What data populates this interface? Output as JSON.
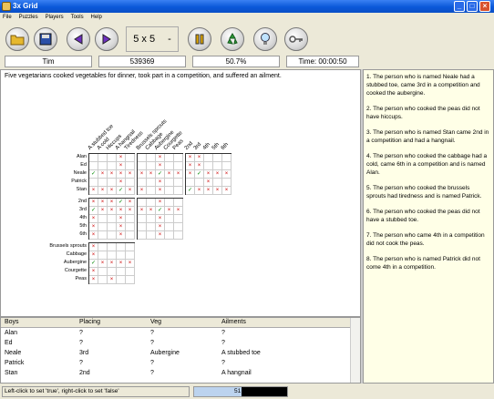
{
  "window": {
    "title": "3x Grid"
  },
  "menu": [
    "File",
    "Puzzles",
    "Players",
    "Tools",
    "Help"
  ],
  "toolbar": {
    "size": "5 x 5",
    "size_suffix": "-"
  },
  "status": {
    "player": "Tim",
    "score": "539369",
    "percent": "50.7%",
    "time": "Time: 00:00:50"
  },
  "intro": "Five vegetarians cooked vegetables for dinner, took part in a competition, and suffered an ailment.",
  "columns": {
    "ailments": [
      "A stubbed toe",
      "A cold",
      "Hiccups",
      "A hangnail",
      "Tiredness"
    ],
    "veg": [
      "Brussels sprouts",
      "Cabbage",
      "Aubergine",
      "Courgette",
      "Peas"
    ],
    "placing": [
      "2nd",
      "3rd",
      "4th",
      "5th",
      "6th"
    ]
  },
  "rows": {
    "boys": [
      "Alan",
      "Ed",
      "Neale",
      "Patrick",
      "Stan"
    ],
    "placing": [
      "2nd",
      "3rd",
      "4th",
      "5th",
      "6th"
    ],
    "veg": [
      "Brussels sprouts",
      "Cabbage",
      "Aubergine",
      "Courgette",
      "Peas"
    ]
  },
  "grid_marks": {
    "boys_ailments": [
      [
        "",
        "",
        "",
        "x",
        ""
      ],
      [
        "",
        "",
        "",
        "x",
        ""
      ],
      [
        "c",
        "x",
        "x",
        "x",
        "x"
      ],
      [
        "",
        "",
        "",
        "x",
        ""
      ],
      [
        "x",
        "x",
        "x",
        "c",
        "x"
      ]
    ],
    "boys_veg": [
      [
        "",
        "",
        "x",
        "",
        ""
      ],
      [
        "",
        "",
        "x",
        "",
        ""
      ],
      [
        "x",
        "x",
        "c",
        "x",
        "x"
      ],
      [
        "",
        "",
        "x",
        "",
        ""
      ],
      [
        "x",
        "",
        "x",
        "",
        ""
      ]
    ],
    "boys_placing": [
      [
        "x",
        "x",
        "",
        "",
        ""
      ],
      [
        "x",
        "x",
        "",
        "",
        ""
      ],
      [
        "x",
        "c",
        "x",
        "x",
        "x"
      ],
      [
        "",
        "",
        "x",
        "",
        ""
      ],
      [
        "c",
        "x",
        "x",
        "x",
        "x"
      ]
    ],
    "placing_ailments": [
      [
        "x",
        "x",
        "x",
        "c",
        "x"
      ],
      [
        "c",
        "x",
        "x",
        "x",
        "x"
      ],
      [
        "x",
        "",
        "",
        "x",
        ""
      ],
      [
        "x",
        "",
        "",
        "x",
        ""
      ],
      [
        "x",
        "",
        "",
        "x",
        ""
      ]
    ],
    "placing_veg": [
      [
        "",
        "",
        "x",
        "",
        ""
      ],
      [
        "x",
        "x",
        "c",
        "x",
        "x"
      ],
      [
        "",
        "",
        "x",
        "",
        ""
      ],
      [
        "",
        "",
        "x",
        "",
        ""
      ],
      [
        "",
        "",
        "x",
        "",
        ""
      ]
    ],
    "veg_ailments": [
      [
        "x",
        "",
        "",
        "",
        ""
      ],
      [
        "x",
        "",
        "",
        "",
        ""
      ],
      [
        "c",
        "x",
        "x",
        "x",
        "x"
      ],
      [
        "x",
        "",
        "",
        "",
        ""
      ],
      [
        "x",
        "",
        "x",
        "",
        ""
      ]
    ]
  },
  "clues": [
    "1. The person who is named Neale had a stubbed toe, came 3rd in a competition and cooked the aubergine.",
    "2. The person who cooked the peas did not have hiccups.",
    "3. The person who is named Stan came 2nd in a competition and had a hangnail.",
    "4. The person who cooked the cabbage had a cold, came 6th in a competition and is named Alan.",
    "5. The person who cooked the brussels sprouts had tiredness and is named Patrick.",
    "6. The person who cooked the peas did not have a stubbed toe.",
    "7. The person who came 4th in a competition did not cook the peas.",
    "8. The person who is named Patrick did not come 4th in a competition."
  ],
  "table": {
    "headers": [
      "Boys",
      "Placing",
      "Veg",
      "Ailments"
    ],
    "rows": [
      [
        "Alan",
        "?",
        "?",
        "?"
      ],
      [
        "Ed",
        "?",
        "?",
        "?"
      ],
      [
        "Neale",
        "3rd",
        "Aubergine",
        "A stubbed toe"
      ],
      [
        "Patrick",
        "?",
        "?",
        "?"
      ],
      [
        "Stan",
        "2nd",
        "?",
        "A hangnail"
      ]
    ]
  },
  "statusbar": {
    "hint": "Left-click to set 'true', right-click to set 'false'",
    "progress_text": "51",
    "progress": 0.51
  }
}
